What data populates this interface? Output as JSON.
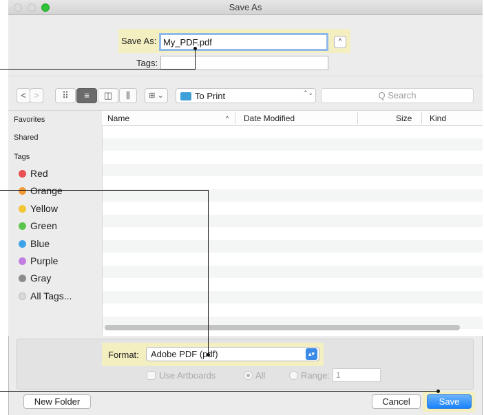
{
  "window": {
    "title": "Save As"
  },
  "save_area": {
    "save_as_label": "Save As:",
    "filename": "My_PDF.pdf",
    "tags_label": "Tags:",
    "tags_value": "",
    "expand_glyph": "^"
  },
  "toolbar": {
    "back_glyph": "<",
    "forward_glyph": ">",
    "icon_view_glyph": "⠿",
    "list_view_glyph": "≡",
    "column_view_glyph": "◫",
    "coverflow_glyph": "⫼",
    "arrange_glyph": "⊞ ⌄",
    "location": "To Print",
    "location_arrows": "⌃⌄",
    "search_placeholder": "Q Search"
  },
  "sidebar": {
    "favorites": "Favorites",
    "shared": "Shared",
    "tags_header": "Tags",
    "tags": [
      {
        "label": "Red",
        "color": "#ec5050"
      },
      {
        "label": "Orange",
        "color": "#f19a37"
      },
      {
        "label": "Yellow",
        "color": "#f4c534"
      },
      {
        "label": "Green",
        "color": "#5ac54c"
      },
      {
        "label": "Blue",
        "color": "#3fa3ea"
      },
      {
        "label": "Purple",
        "color": "#c27ee0"
      },
      {
        "label": "Gray",
        "color": "#8c8c8c"
      },
      {
        "label": "All Tags...",
        "color": "#d9d9d9"
      }
    ]
  },
  "file_list": {
    "columns": [
      "Name",
      "Date Modified",
      "Size",
      "Kind"
    ],
    "sort_glyph": "^"
  },
  "options": {
    "format_label": "Format:",
    "format_value": "Adobe PDF (pdf)",
    "use_artboards": "Use Artboards",
    "all": "All",
    "range": "Range:",
    "range_value": "1"
  },
  "footer": {
    "new_folder": "New Folder",
    "cancel": "Cancel",
    "save": "Save"
  },
  "colors": {
    "highlight": "#f4efc1",
    "accent": "#1a82fb",
    "folder": "#3ea0d8"
  }
}
